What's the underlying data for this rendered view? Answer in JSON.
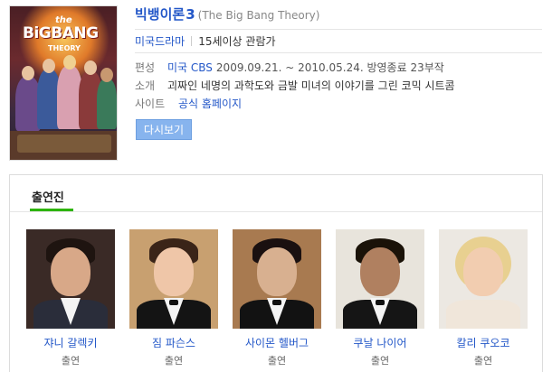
{
  "show": {
    "title": "빅뱅이론",
    "season": "3",
    "original_title": "(The Big Bang Theory)",
    "genre": "미국드라마",
    "rating": "15세이상 관람가",
    "poster": {
      "logo_the": "the",
      "logo_main": "BiGBANG",
      "logo_sub": "THEORY"
    }
  },
  "meta": {
    "broadcast_label": "편성",
    "broadcast_network": "미국 CBS",
    "broadcast_details": "2009.09.21. ~ 2010.05.24. 방영종료 23부작",
    "synopsis_label": "소개",
    "synopsis": "괴짜인 네명의 과학도와 금발 미녀의 이야기를 그린 코믹 시트콤",
    "site_label": "사이트",
    "site_link": "공식 홈페이지"
  },
  "replay_button": "다시보기",
  "cast_section": {
    "tab_label": "출연진",
    "members": [
      {
        "name": "쟈니 갈렉키",
        "role": "출연"
      },
      {
        "name": "짐 파슨스",
        "role": "출연"
      },
      {
        "name": "사이몬 헬버그",
        "role": "출연"
      },
      {
        "name": "쿠날 나이어",
        "role": "출연"
      },
      {
        "name": "칼리 쿠오코",
        "role": "출연"
      }
    ]
  },
  "colors": {
    "link": "#2357c8",
    "tab_underline": "#2db400",
    "button": "#87b4ee"
  }
}
